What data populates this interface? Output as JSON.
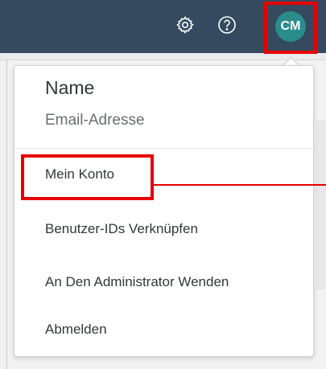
{
  "header": {
    "settings_icon": "gear-icon",
    "help_icon": "question-mark-circle-icon",
    "avatar_initials": "CM"
  },
  "user_menu": {
    "name": "Name",
    "email": "Email-Adresse",
    "items": [
      {
        "label": "Mein Konto"
      },
      {
        "label": "Benutzer-IDs Verknüpfen"
      },
      {
        "label": "An Den Administrator Wenden"
      },
      {
        "label": "Abmelden"
      }
    ]
  },
  "colors": {
    "header_bg": "#354a5f",
    "avatar_bg": "#2a8c8c",
    "highlight": "#e60000"
  }
}
